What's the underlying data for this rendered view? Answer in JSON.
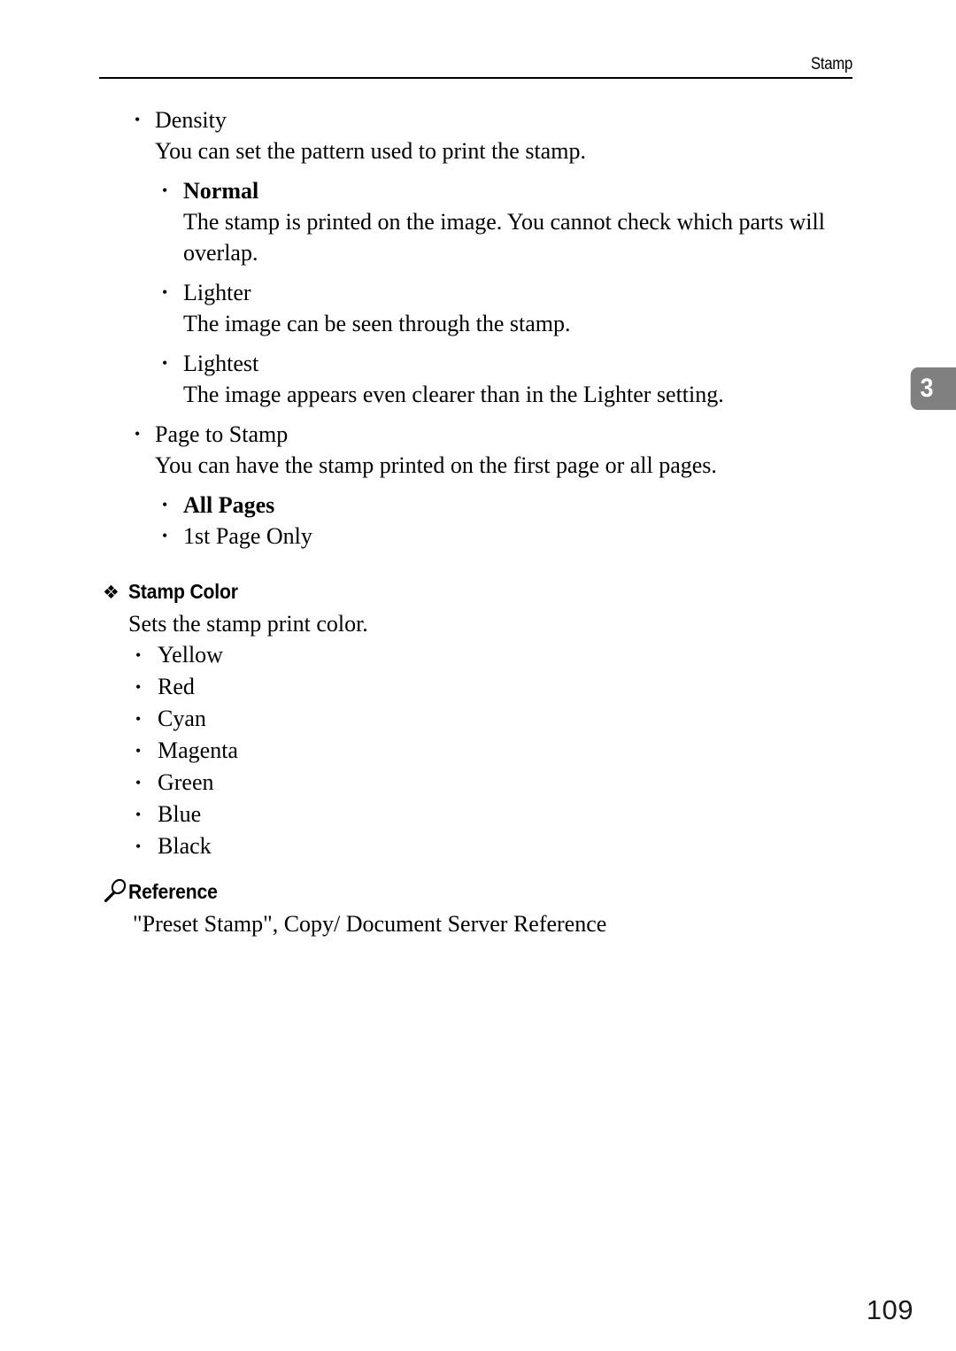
{
  "header": {
    "title": "Stamp"
  },
  "chapter_tab": {
    "number": "3"
  },
  "content": {
    "density": {
      "label": "Density",
      "description": "You can set the pattern used to print the stamp.",
      "options": [
        {
          "label": "Normal",
          "bold": true,
          "description": "The stamp is printed on the image. You cannot check which parts will overlap."
        },
        {
          "label": "Lighter",
          "bold": false,
          "description": "The image can be seen through the stamp."
        },
        {
          "label": "Lightest",
          "bold": false,
          "description": "The image appears even clearer than in the Lighter setting."
        }
      ]
    },
    "page_to_stamp": {
      "label": "Page to Stamp",
      "description": "You can have the stamp printed on the first page or all pages.",
      "options": [
        {
          "label": "All Pages",
          "bold": true
        },
        {
          "label": "1st Page Only",
          "bold": false
        }
      ]
    },
    "stamp_color": {
      "heading": "Stamp Color",
      "description": "Sets the stamp print color.",
      "colors": [
        "Yellow",
        "Red",
        "Cyan",
        "Magenta",
        "Green",
        "Blue",
        "Black"
      ]
    },
    "reference": {
      "title": "Reference",
      "text": "\"Preset Stamp\", Copy/ Document Server Reference"
    }
  },
  "bullets": {
    "round": "•",
    "diamond": "❖"
  },
  "footer": {
    "page_number": "109"
  },
  "colors": {
    "text": "#000000",
    "tab_background": "#808080",
    "tab_text": "#ffffff",
    "page_background": "#ffffff"
  }
}
